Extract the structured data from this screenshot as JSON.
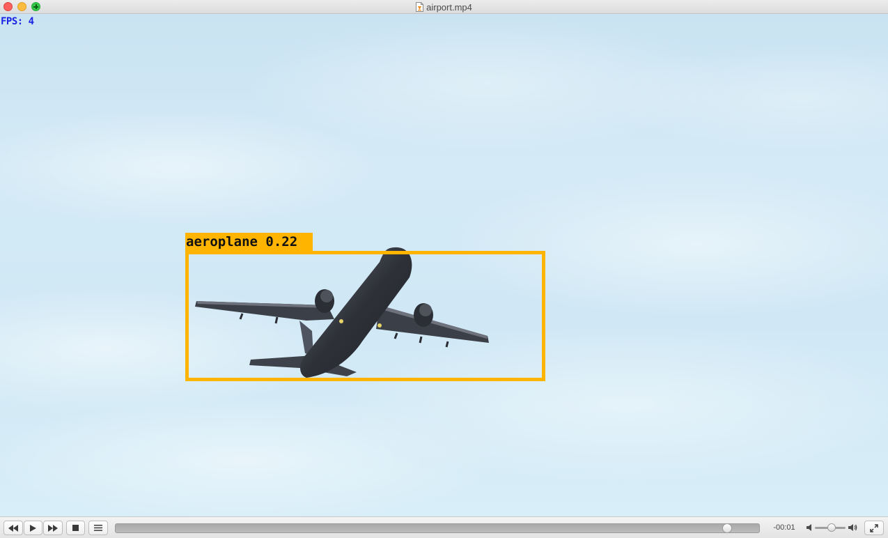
{
  "window": {
    "title": "airport.mp4",
    "file_icon": "video-file-icon"
  },
  "video": {
    "fps_text": "FPS: 4",
    "detection": {
      "label": "aeroplane 0.22",
      "class": "aeroplane",
      "score": 0.22,
      "box_color": "#ffb500"
    }
  },
  "controls": {
    "rewind_icon": "rewind-icon",
    "play_icon": "play-icon",
    "fast_forward_icon": "fast-forward-icon",
    "stop_icon": "stop-icon",
    "playlist_icon": "playlist-icon",
    "seek_progress": 0.95,
    "time_remaining": "-00:01",
    "volume_level": 0.55,
    "fullscreen_icon": "fullscreen-icon"
  }
}
